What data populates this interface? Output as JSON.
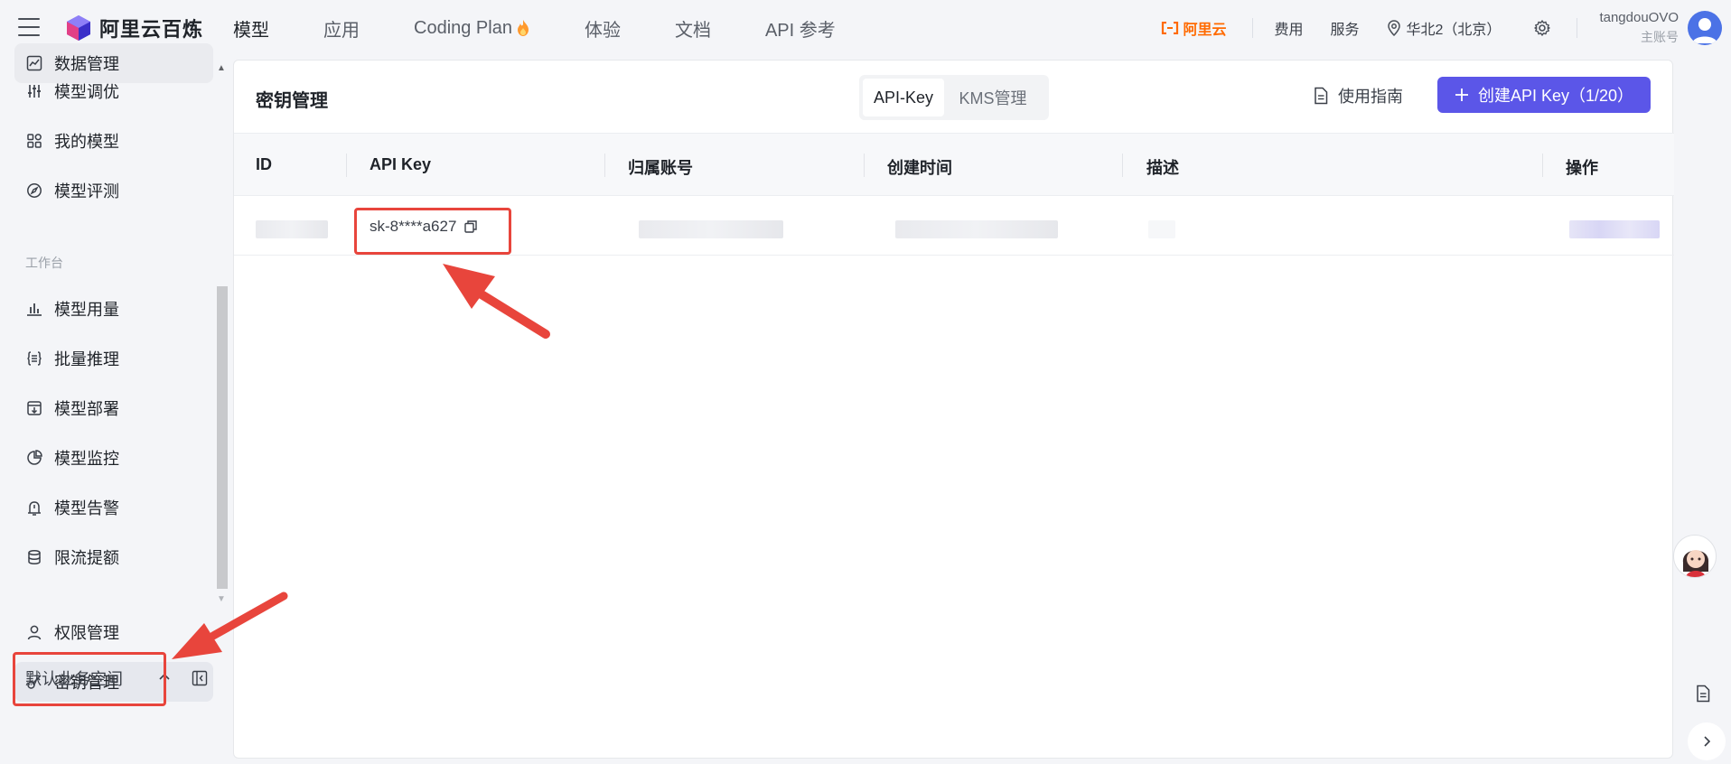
{
  "topbar": {
    "logo_text": "阿里云百炼",
    "nav": [
      {
        "label": "模型",
        "active": true
      },
      {
        "label": "应用"
      },
      {
        "label": "Coding Plan",
        "icon": "flame-icon"
      },
      {
        "label": "体验"
      },
      {
        "label": "文档"
      },
      {
        "label": "API 参考"
      }
    ],
    "aliyun_label": "阿里云",
    "links": [
      "费用",
      "服务"
    ],
    "region": "华北2（北京）",
    "username": "tangdouOVO",
    "user_role": "主账号"
  },
  "sidebar": {
    "top_items": [
      {
        "label": "数据管理",
        "icon": "chart-line-icon"
      },
      {
        "label": "模型调优",
        "icon": "sliders-icon"
      },
      {
        "label": "我的模型",
        "icon": "apps-grid-icon"
      },
      {
        "label": "模型评测",
        "icon": "compass-icon"
      }
    ],
    "section_label": "工作台",
    "work_items": [
      {
        "label": "模型用量",
        "icon": "bar-chart-icon"
      },
      {
        "label": "批量推理",
        "icon": "braces-list-icon"
      },
      {
        "label": "模型部署",
        "icon": "download-box-icon"
      },
      {
        "label": "模型监控",
        "icon": "pie-chart-icon"
      },
      {
        "label": "模型告警",
        "icon": "alarm-bell-icon"
      },
      {
        "label": "限流提额",
        "icon": "database-icon"
      }
    ],
    "bottom_items": [
      {
        "label": "权限管理",
        "icon": "user-icon"
      },
      {
        "label": "密钥管理",
        "icon": "key-icon",
        "active": true
      }
    ],
    "workspace_label": "默认业务空间"
  },
  "main": {
    "title": "密钥管理",
    "segments": {
      "active": "API-Key",
      "other": "KMS管理"
    },
    "guide_label": "使用指南",
    "create_button": "创建API Key（1/20）",
    "columns": [
      "ID",
      "API Key",
      "归属账号",
      "创建时间",
      "描述",
      "操作"
    ],
    "rows": [
      {
        "api_key": "sk-8****a627"
      }
    ]
  },
  "colors": {
    "primary": "#5b56e8",
    "annotation_red": "#e8453c",
    "aliyun_orange": "#ff6a00"
  }
}
